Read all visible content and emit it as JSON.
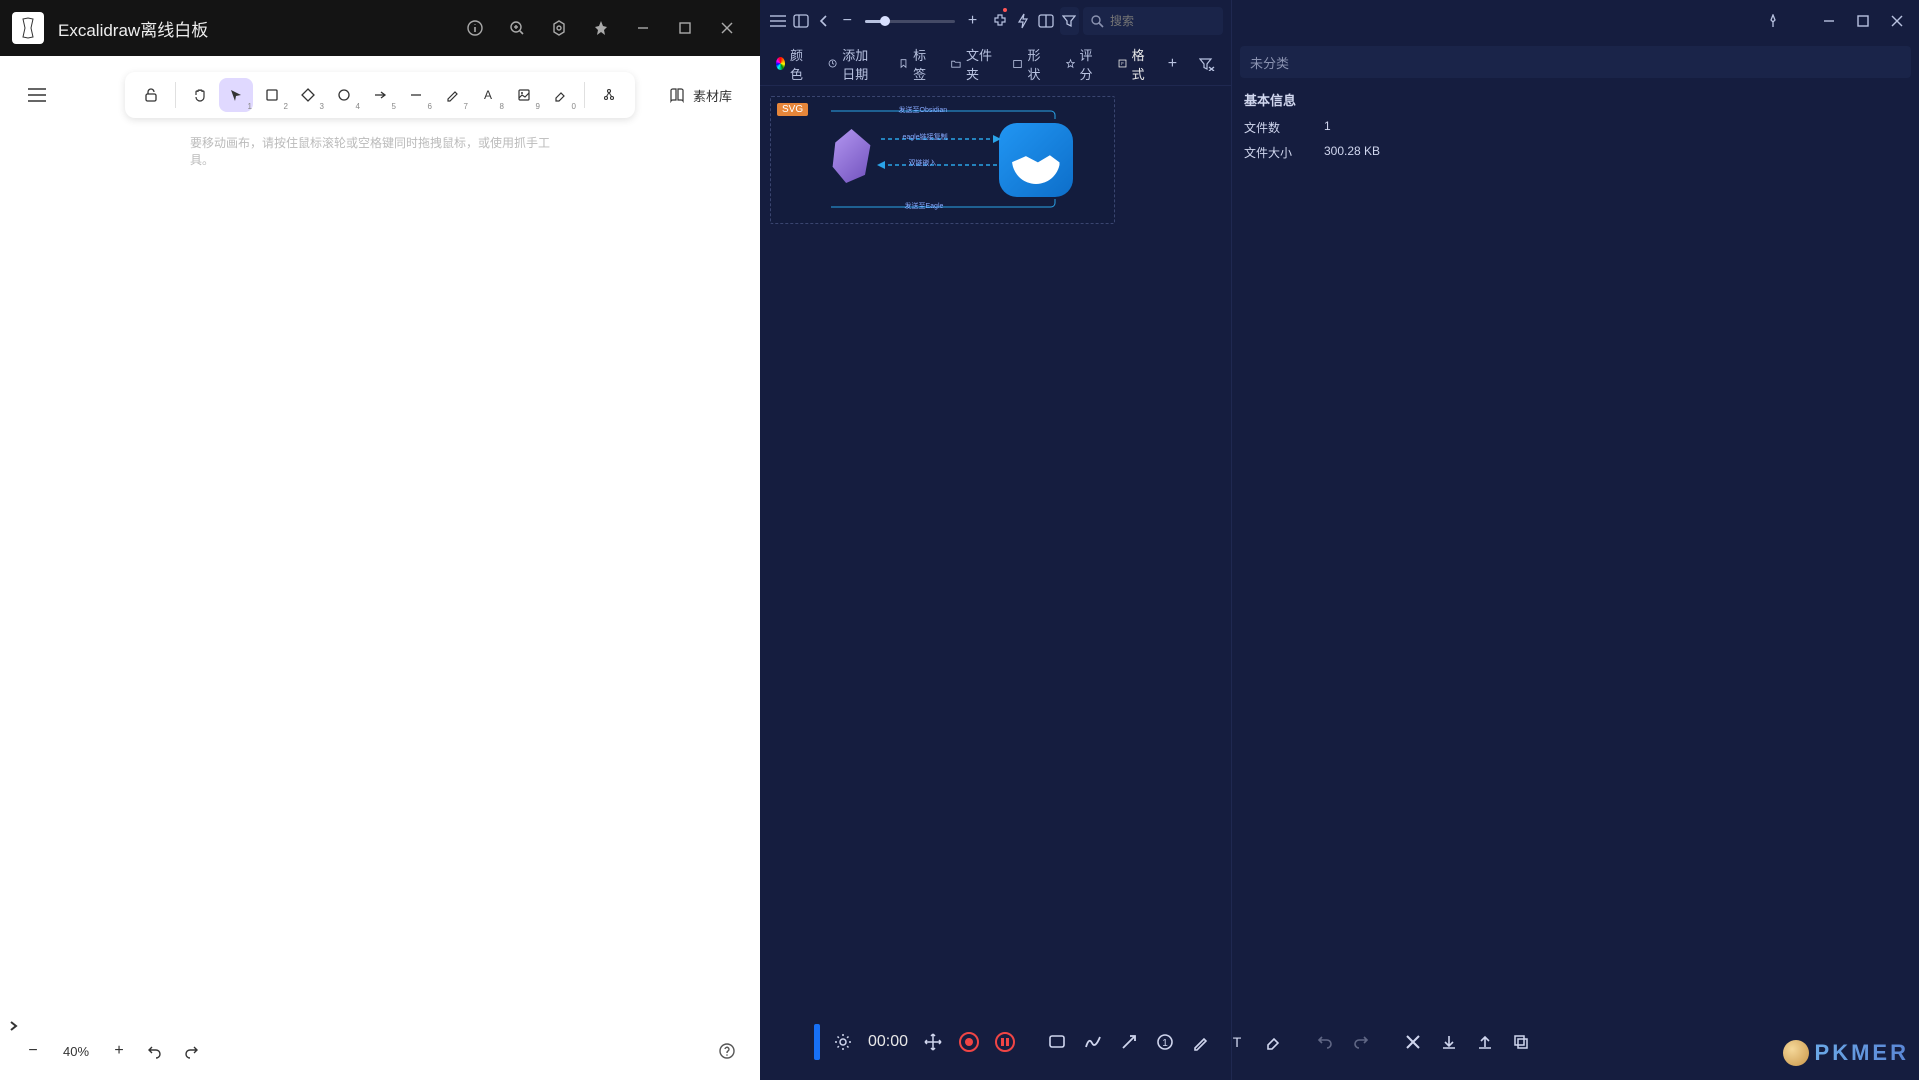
{
  "left": {
    "title": "Excalidraw离线白板",
    "hint": "要移动画布，请按住鼠标滚轮或空格键同时拖拽鼠标，或使用抓手工具。",
    "library": "素材库",
    "zoom": "40%",
    "tools": {
      "lock": "lock",
      "hand": "hand",
      "select": "1",
      "rect": "2",
      "diamond": "3",
      "ellipse": "4",
      "arrow": "5",
      "line": "6",
      "pencil": "7",
      "text": "8",
      "image": "9",
      "erase": "0",
      "more": "more"
    }
  },
  "right": {
    "search_placeholder": "搜索",
    "tabs": {
      "color": "颜色",
      "date": "添加日期",
      "tag": "标签",
      "folder": "文件夹",
      "shape": "形状",
      "rating": "评分",
      "format": "格式"
    },
    "badge": "SVG",
    "diagram_labels": {
      "top": "发送至Obsidian",
      "mid1": "eagle链接复制",
      "mid2": "双链嵌入",
      "bottom": "发送至Eagle"
    },
    "side": {
      "uncategorized": "未分类",
      "section": "基本信息",
      "file_count_k": "文件数",
      "file_count_v": "1",
      "file_size_k": "文件大小",
      "file_size_v": "300.28 KB"
    },
    "timer": "00:00",
    "watermark": "PKMER"
  }
}
